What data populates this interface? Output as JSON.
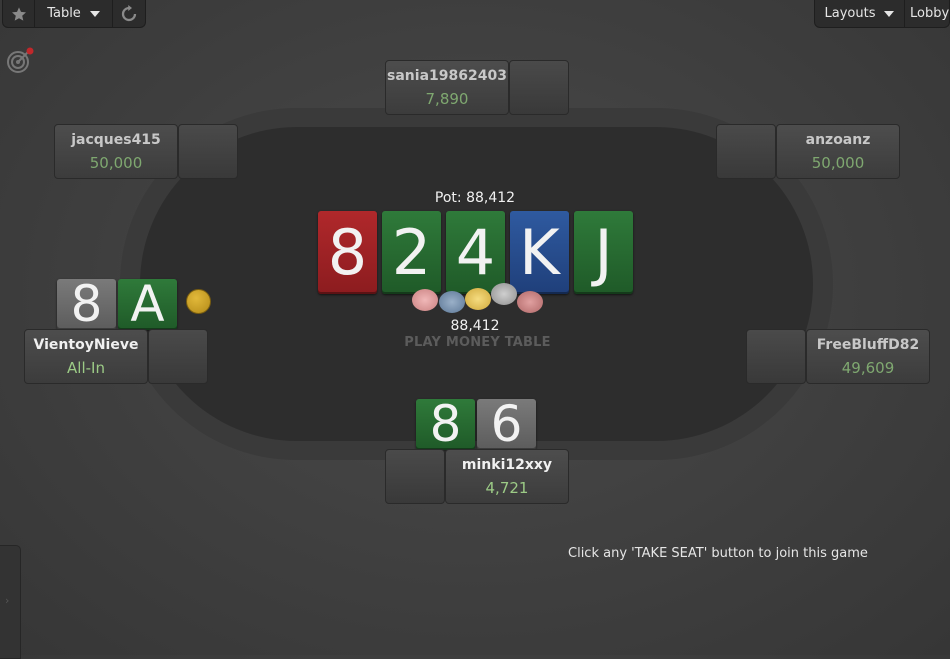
{
  "toolbar": {
    "favorite_icon": "star-icon",
    "table_label": "Table",
    "refresh_icon": "refresh-icon",
    "layouts_label": "Layouts",
    "lobby_label": "Lobby"
  },
  "table": {
    "pot_label": "Pot: 88,412",
    "pot_amount": "88,412",
    "play_money_label": "PLAY MONEY TABLE",
    "board": [
      {
        "rank": "8",
        "color": "#a82326"
      },
      {
        "rank": "2",
        "color": "#2a6e34"
      },
      {
        "rank": "4",
        "color": "#2a6e34"
      },
      {
        "rank": "K",
        "color": "#2a4f90"
      },
      {
        "rank": "J",
        "color": "#2a6e34"
      }
    ],
    "pot_chip_colors": [
      "#d99a9a",
      "#6f8aa8",
      "#e3c15a",
      "#a8a8a8",
      "#c47f7f"
    ]
  },
  "seats": {
    "top": {
      "name": "sania19862403",
      "stack": "7,890"
    },
    "top_left": {
      "name": "jacques415",
      "stack": "50,000"
    },
    "top_right": {
      "name": "anzoanz",
      "stack": "50,000"
    },
    "left": {
      "name": "VientoyNieve",
      "stack": "All-In",
      "cards": [
        "8",
        "A"
      ]
    },
    "right": {
      "name": "FreeBluffD82",
      "stack": "49,609"
    },
    "bottom": {
      "name": "minki12xxy",
      "stack": "4,721",
      "cards": [
        "8",
        "6"
      ]
    }
  },
  "join_message": "Click any 'TAKE SEAT' button to join this game",
  "colors": {
    "felt": "#2d2d2d",
    "stack_green": "#7fa870",
    "dealer_button": "#d4a62a"
  }
}
